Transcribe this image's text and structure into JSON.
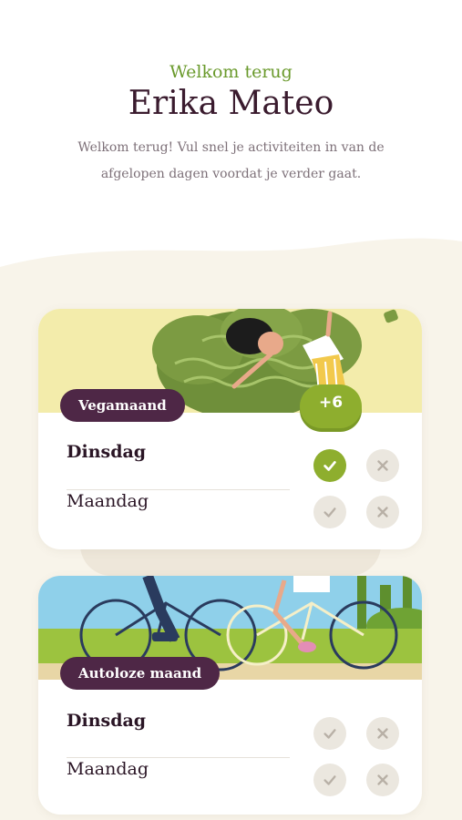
{
  "header": {
    "greeting": "Welkom terug",
    "name": "Erika Mateo",
    "intro": "Welkom terug! Vul snel je activiteiten in van de afgelopen dagen voordat je verder gaat."
  },
  "cards": [
    {
      "badge": "Vegamaand",
      "extra_count": "+6",
      "days": [
        {
          "label": "Dinsdag",
          "done": true
        },
        {
          "label": "Maandag",
          "done": false
        }
      ]
    },
    {
      "badge": "Autoloze maand",
      "days": [
        {
          "label": "Dinsdag",
          "done": false
        },
        {
          "label": "Maandag",
          "done": false
        }
      ]
    }
  ],
  "colors": {
    "accent_green": "#8eae2e",
    "badge_purple": "#4e2746",
    "title_dark": "#3a1b2e",
    "greeting_green": "#6a9a2c",
    "background_cream": "#f8f4ea"
  },
  "icons": {
    "confirm": "check-icon",
    "dismiss": "close-icon"
  }
}
